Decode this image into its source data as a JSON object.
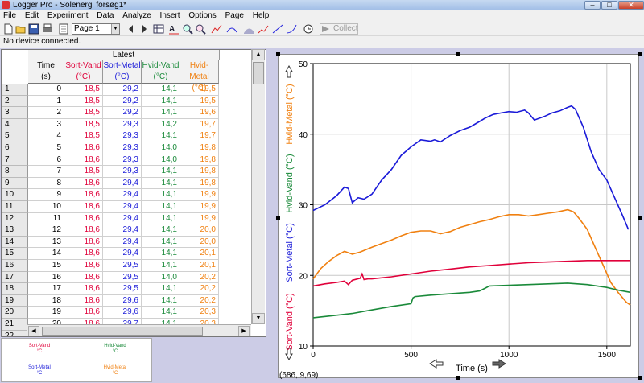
{
  "window": {
    "title": "Logger Pro - Solenergi forsøg1*",
    "minimize_label": "–",
    "maximize_label": "□",
    "close_label": "✕"
  },
  "menu": [
    "File",
    "Edit",
    "Experiment",
    "Data",
    "Analyze",
    "Insert",
    "Options",
    "Page",
    "Help"
  ],
  "toolbar": {
    "page_select_value": "Page 1",
    "collect_label": "Collect",
    "icons": [
      "new-file",
      "open-folder",
      "save",
      "print",
      "page-select",
      "page-prev",
      "page-next",
      "autoscale",
      "zoom-in",
      "zoom-out",
      "examine",
      "tangent",
      "integral",
      "statistics",
      "linear-fit",
      "curve-fit",
      "timer",
      "collect"
    ]
  },
  "status": "No device connected.",
  "table": {
    "group_header": "Latest",
    "columns": [
      {
        "name": "Time",
        "unit": "(s)",
        "color": "#000000"
      },
      {
        "name": "Sort-Vand",
        "unit": "(°C)",
        "color": "#e0003a"
      },
      {
        "name": "Sort-Metal",
        "unit": "(°C)",
        "color": "#1a1ad8"
      },
      {
        "name": "Hvid-Vand",
        "unit": "(°C)",
        "color": "#1a8a3a"
      },
      {
        "name": "Hvid-Metal",
        "unit": "(°C)",
        "color": "#f08010"
      }
    ],
    "rows": [
      [
        "1",
        "0",
        "18,5",
        "29,2",
        "14,1",
        "19,5"
      ],
      [
        "2",
        "1",
        "18,5",
        "29,2",
        "14,1",
        "19,5"
      ],
      [
        "3",
        "2",
        "18,5",
        "29,2",
        "14,1",
        "19,6"
      ],
      [
        "4",
        "3",
        "18,5",
        "29,3",
        "14,2",
        "19,7"
      ],
      [
        "5",
        "4",
        "18,5",
        "29,3",
        "14,1",
        "19,7"
      ],
      [
        "6",
        "5",
        "18,6",
        "29,3",
        "14,0",
        "19,8"
      ],
      [
        "7",
        "6",
        "18,6",
        "29,3",
        "14,0",
        "19,8"
      ],
      [
        "8",
        "7",
        "18,5",
        "29,3",
        "14,1",
        "19,8"
      ],
      [
        "9",
        "8",
        "18,6",
        "29,4",
        "14,1",
        "19,8"
      ],
      [
        "10",
        "9",
        "18,6",
        "29,4",
        "14,1",
        "19,9"
      ],
      [
        "11",
        "10",
        "18,6",
        "29,4",
        "14,1",
        "19,9"
      ],
      [
        "12",
        "11",
        "18,6",
        "29,4",
        "14,1",
        "19,9"
      ],
      [
        "13",
        "12",
        "18,6",
        "29,4",
        "14,1",
        "20,0"
      ],
      [
        "14",
        "13",
        "18,6",
        "29,4",
        "14,1",
        "20,0"
      ],
      [
        "15",
        "14",
        "18,6",
        "29,4",
        "14,1",
        "20,1"
      ],
      [
        "16",
        "15",
        "18,6",
        "29,5",
        "14,1",
        "20,1"
      ],
      [
        "17",
        "16",
        "18,6",
        "29,5",
        "14,0",
        "20,2"
      ],
      [
        "18",
        "17",
        "18,6",
        "29,5",
        "14,1",
        "20,2"
      ],
      [
        "19",
        "18",
        "18,6",
        "29,6",
        "14,1",
        "20,2"
      ],
      [
        "20",
        "19",
        "18,6",
        "29,6",
        "14,1",
        "20,3"
      ],
      [
        "21",
        "20",
        "18,6",
        "29,7",
        "14,1",
        "20,3"
      ],
      [
        "22",
        "",
        "",
        "",
        "",
        ""
      ]
    ]
  },
  "legend": [
    {
      "name": "Sort-Vand",
      "unit": "°C",
      "color": "#e0003a"
    },
    {
      "name": "Hvid-Vand",
      "unit": "°C",
      "color": "#1a8a3a"
    },
    {
      "name": "Sort-Metal",
      "unit": "°C",
      "color": "#1a1ad8"
    },
    {
      "name": "Hvid-Metal",
      "unit": "°C",
      "color": "#f08010"
    }
  ],
  "graph": {
    "cursor_readout": "(686, 9,69)",
    "y_axis_labels": [
      {
        "text": "Sort-Vand (°C)",
        "color": "#e0003a"
      },
      {
        "text": "Sort-Metal (°C)",
        "color": "#1a1ad8"
      },
      {
        "text": "Hvid-Vand (°C)",
        "color": "#1a8a3a"
      },
      {
        "text": "Hvid-Metal (°C)",
        "color": "#f08010"
      }
    ]
  },
  "chart_data": {
    "type": "line",
    "xlabel": "Time (s)",
    "ylabel": "",
    "xlim": [
      0,
      1620
    ],
    "ylim": [
      10,
      50
    ],
    "x_ticks": [
      0,
      500,
      1000,
      1500
    ],
    "y_ticks": [
      10,
      20,
      30,
      40,
      50
    ],
    "grid": true,
    "series": [
      {
        "name": "Sort-Metal",
        "color": "#1a1ad8",
        "x": [
          0,
          60,
          120,
          160,
          180,
          200,
          230,
          260,
          300,
          350,
          400,
          450,
          500,
          550,
          600,
          620,
          650,
          700,
          750,
          800,
          850,
          880,
          920,
          960,
          1000,
          1040,
          1080,
          1100,
          1130,
          1180,
          1220,
          1260,
          1300,
          1320,
          1340,
          1380,
          1420,
          1460,
          1500,
          1540,
          1580,
          1610
        ],
        "y": [
          29.2,
          30.0,
          31.3,
          32.5,
          32.3,
          30.3,
          31.0,
          30.8,
          31.5,
          33.5,
          35.0,
          37.0,
          38.2,
          39.2,
          39.0,
          39.2,
          38.9,
          39.8,
          40.5,
          41.0,
          41.8,
          42.3,
          42.8,
          43.0,
          43.2,
          43.1,
          43.4,
          43.0,
          42.0,
          42.5,
          43.0,
          43.3,
          43.8,
          44.0,
          43.5,
          41.0,
          37.5,
          35.0,
          33.5,
          31.0,
          28.5,
          26.5
        ]
      },
      {
        "name": "Hvid-Metal",
        "color": "#f08010",
        "x": [
          0,
          40,
          80,
          120,
          160,
          200,
          240,
          300,
          350,
          400,
          450,
          500,
          550,
          600,
          650,
          700,
          750,
          800,
          850,
          900,
          950,
          1000,
          1050,
          1100,
          1150,
          1200,
          1250,
          1300,
          1330,
          1360,
          1400,
          1440,
          1480,
          1520,
          1560,
          1600,
          1620
        ],
        "y": [
          19.5,
          21.0,
          22.0,
          22.8,
          23.4,
          23.0,
          23.3,
          24.0,
          24.5,
          25.0,
          25.6,
          26.1,
          26.3,
          26.3,
          25.9,
          26.2,
          26.8,
          27.2,
          27.6,
          27.9,
          28.3,
          28.6,
          28.6,
          28.4,
          28.6,
          28.8,
          29.0,
          29.3,
          29.0,
          28.0,
          26.5,
          24.0,
          21.5,
          19.0,
          17.5,
          16.2,
          15.8
        ]
      },
      {
        "name": "Sort-Vand",
        "color": "#e0003a",
        "x": [
          0,
          60,
          120,
          160,
          180,
          200,
          240,
          250,
          260,
          280,
          300,
          400,
          500,
          600,
          700,
          800,
          900,
          1000,
          1100,
          1200,
          1300,
          1400,
          1500,
          1620
        ],
        "y": [
          18.5,
          18.8,
          19.0,
          19.2,
          18.7,
          19.3,
          19.6,
          20.2,
          19.4,
          19.5,
          19.5,
          19.8,
          20.2,
          20.6,
          20.9,
          21.2,
          21.4,
          21.6,
          21.8,
          21.9,
          22.0,
          22.1,
          22.1,
          22.1
        ]
      },
      {
        "name": "Hvid-Vand",
        "color": "#1a8a3a",
        "x": [
          0,
          100,
          200,
          300,
          400,
          500,
          510,
          520,
          600,
          700,
          800,
          850,
          880,
          900,
          1000,
          1100,
          1200,
          1300,
          1400,
          1500,
          1560,
          1620
        ],
        "y": [
          14.0,
          14.3,
          14.6,
          15.1,
          15.6,
          16.0,
          16.8,
          17.0,
          17.2,
          17.4,
          17.6,
          17.8,
          18.2,
          18.5,
          18.6,
          18.7,
          18.8,
          18.9,
          18.7,
          18.3,
          17.9,
          17.6
        ]
      }
    ]
  }
}
